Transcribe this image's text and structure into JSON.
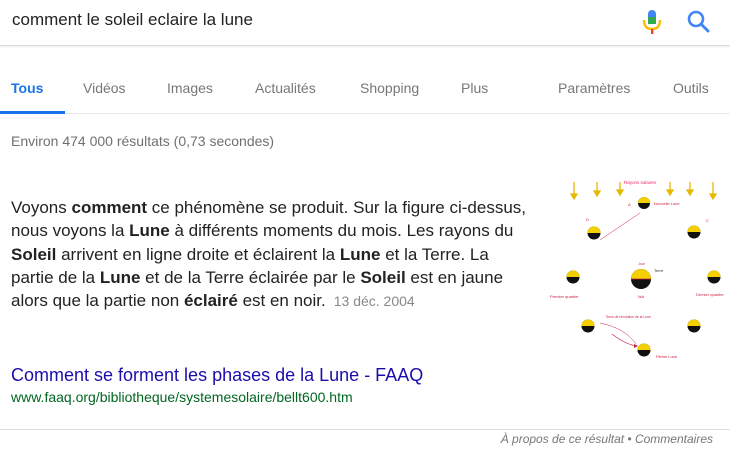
{
  "search": {
    "query": "comment le soleil eclaire la lune",
    "mic_icon": "mic-icon",
    "search_icon": "search-icon"
  },
  "tabs": {
    "items": [
      {
        "label": "Tous",
        "active": true
      },
      {
        "label": "Vidéos",
        "active": false
      },
      {
        "label": "Images",
        "active": false
      },
      {
        "label": "Actualités",
        "active": false
      },
      {
        "label": "Shopping",
        "active": false
      },
      {
        "label": "Plus",
        "active": false
      }
    ],
    "settings": "Paramètres",
    "tools": "Outils"
  },
  "stats": "Environ 474 000 résultats (0,73 secondes)",
  "snippet": {
    "parts": [
      {
        "t": "Voyons ",
        "b": false
      },
      {
        "t": "comment",
        "b": true
      },
      {
        "t": " ce phénomène se produit. Sur la figure ci-dessus, nous voyons la ",
        "b": false
      },
      {
        "t": "Lune",
        "b": true
      },
      {
        "t": " à différents moments du mois. Les rayons du ",
        "b": false
      },
      {
        "t": "Soleil",
        "b": true
      },
      {
        "t": " arrivent en ligne droite et éclairent la ",
        "b": false
      },
      {
        "t": "Lune",
        "b": true
      },
      {
        "t": " et la Terre. La partie de la ",
        "b": false
      },
      {
        "t": "Lune",
        "b": true
      },
      {
        "t": " et de la Terre éclairée par le ",
        "b": false
      },
      {
        "t": "Soleil",
        "b": true
      },
      {
        "t": " est en jaune alors que la partie non ",
        "b": false
      },
      {
        "t": "éclairé",
        "b": true
      },
      {
        "t": " est en noir.",
        "b": false
      }
    ],
    "date": "13 déc. 2004",
    "title": "Comment se forment les phases de la Lune - FAAQ",
    "url": "www.faaq.org/bibliotheque/systemesolaire/bellt600.htm",
    "figure_labels": {
      "top": "Rayons solaires",
      "new_moon": "Nouvelle Lune",
      "earth": "Terre",
      "day": "Jour",
      "night": "Nuit",
      "first_quarter": "Premier quartier",
      "last_quarter": "Dernier quartier",
      "full_moon": "Pleine Lune",
      "orbit": "Sens de révolution de la Lune",
      "d": "D",
      "c": "C",
      "a": "A"
    }
  },
  "footer": {
    "about": "À propos de ce résultat",
    "separator": " • ",
    "feedback": "Commentaires"
  },
  "colors": {
    "accent": "#1a73e8",
    "link": "#1a0dab",
    "url": "#006621",
    "moon_lit": "#f5d000",
    "moon_dark": "#111111"
  }
}
